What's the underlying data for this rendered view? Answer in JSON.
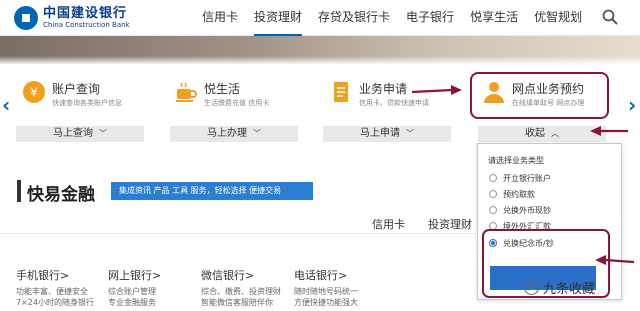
{
  "logo": {
    "name_cn": "中国建设银行",
    "name_en": "China Construction Bank"
  },
  "nav": {
    "items": [
      "信用卡",
      "投资理财",
      "存贷及银行卡",
      "电子银行",
      "悦享生活",
      "优智规划"
    ],
    "active": 1
  },
  "services": [
    {
      "title": "账户查询",
      "subtitle": "快速查询各类账户信息",
      "button": "马上查询"
    },
    {
      "title": "悦生活",
      "subtitle": "生活缴费充值 信用卡",
      "button": "马上办理"
    },
    {
      "title": "业务申请",
      "subtitle": "信用卡、贷款快速申请",
      "button": "马上申请"
    },
    {
      "title": "网点业务预约",
      "subtitle": "在线填单取号 网点办理",
      "button": "收起"
    }
  ],
  "nav_arrows": {
    "left": "‹",
    "right": "›"
  },
  "kuaiyi": {
    "title": "快易金融",
    "badge": "集成资讯 产品 工具 服务，轻松选择 便捷交易",
    "tabs": [
      "信用卡",
      "投资理财"
    ]
  },
  "channels": [
    {
      "title": "手机银行>",
      "lines": [
        "功能丰富、便捷安全",
        "7×24小时的随身银行"
      ]
    },
    {
      "title": "网上银行>",
      "lines": [
        "综合账户管理",
        "专业金融服务"
      ]
    },
    {
      "title": "微信银行>",
      "lines": [
        "综合、缴费、投资理财",
        "智能微信客服陪伴你"
      ]
    },
    {
      "title": "电话银行>",
      "lines": [
        "随时随地号码统一",
        "方便快捷功能强大"
      ]
    }
  ],
  "dropdown": {
    "prompt": "请选择业务类型",
    "options": [
      "开立银行账户",
      "预约取款",
      "兑换外币现钞",
      "境外外汇汇款",
      "兑换纪念币/钞"
    ],
    "selected_index": 4
  },
  "watermark": "九条收藏",
  "colors": {
    "brand": "#0066b3",
    "annotation": "#8b1538",
    "button": "#2a6fc9"
  }
}
